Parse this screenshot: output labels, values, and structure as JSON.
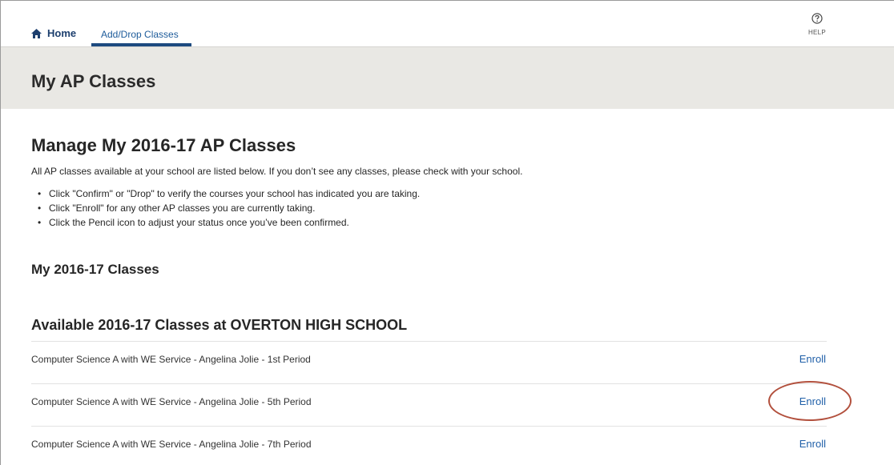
{
  "nav": {
    "home_label": "Home",
    "home_icon": "home-icon",
    "active_tab_label": "Add/Drop Classes",
    "help_label": "HELP",
    "help_icon": "help-circle-icon",
    "accent_color": "#1d4a80"
  },
  "header": {
    "title": "My AP Classes"
  },
  "main": {
    "manage_title": "Manage My 2016-17 AP Classes",
    "intro": "All AP classes available at your school are listed below. If you don’t see any classes, please check with your school.",
    "bullets": [
      "Click \"Confirm\" or \"Drop\" to verify the courses your school has indicated you are taking.",
      "Click \"Enroll\" for any other AP classes you are currently taking.",
      "Click the Pencil icon to adjust your status once you’ve been confirmed."
    ],
    "my_classes_title": "My 2016-17 Classes",
    "available_title": "Available 2016-17 Classes at OVERTON HIGH SCHOOL",
    "classes": [
      {
        "name": "Computer Science A with WE Service - Angelina Jolie - 1st Period",
        "action": "Enroll"
      },
      {
        "name": "Computer Science A with WE Service - Angelina Jolie - 5th Period",
        "action": "Enroll"
      },
      {
        "name": "Computer Science A with WE Service - Angelina Jolie - 7th Period",
        "action": "Enroll"
      }
    ],
    "link_color": "#1f5fa8",
    "annotation_color": "#b2503d"
  }
}
